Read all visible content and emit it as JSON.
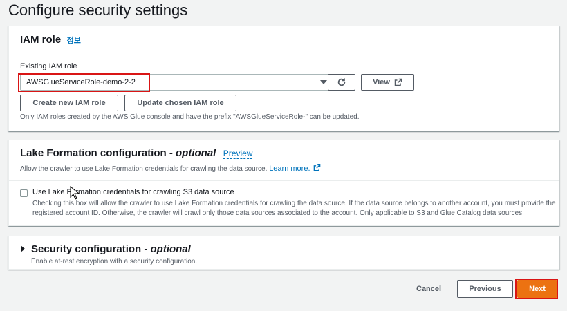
{
  "page": {
    "title": "Configure security settings"
  },
  "iam": {
    "title": "IAM role",
    "info": "정보",
    "field_label": "Existing IAM role",
    "selected_role": "AWSGlueServiceRole-demo-2-2",
    "view_label": "View",
    "create_label": "Create new IAM role",
    "update_label": "Update chosen IAM role",
    "help": "Only IAM roles created by the AWS Glue console and have the prefix \"AWSGlueServiceRole-\" can be updated."
  },
  "lake": {
    "title": "Lake Formation configuration - ",
    "optional": "optional",
    "preview": "Preview",
    "desc": "Allow the crawler to use Lake Formation credentials for crawling the data source.",
    "learn_more": "Learn more.",
    "checkbox_label": "Use Lake Formation credentials for crawling S3 data source",
    "checkbox_desc_1": "Checking this box will allow the crawler to use Lake Formation credentials for crawling the data source. If the data source belongs to another account, you must provide the",
    "checkbox_desc_2": "registered account ID. Otherwise, the crawler will crawl only those data sources associated to the account. Only applicable to S3 and Glue Catalog data sources."
  },
  "security": {
    "title": "Security configuration - ",
    "optional": "optional",
    "desc": "Enable at-rest encryption with a security configuration."
  },
  "footer": {
    "cancel": "Cancel",
    "previous": "Previous",
    "next": "Next"
  },
  "colors": {
    "accent": "#ec7211",
    "link": "#0073bb",
    "highlight": "#d91515"
  }
}
